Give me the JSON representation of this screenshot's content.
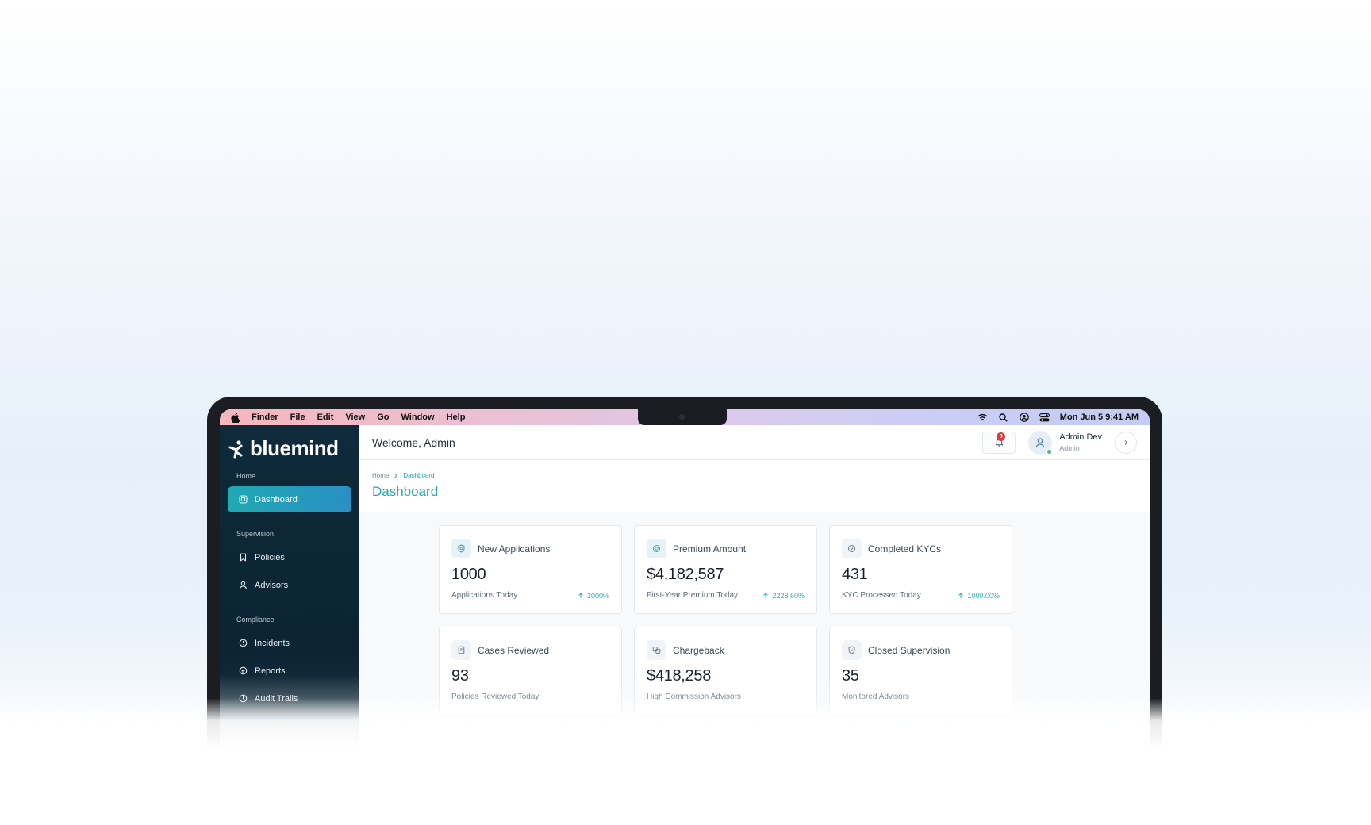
{
  "menubar": {
    "items": [
      "Finder",
      "File",
      "Edit",
      "View",
      "Go",
      "Window",
      "Help"
    ],
    "clock": "Mon Jun 5  9:41 AM",
    "status_icons": [
      "wifi-icon",
      "search-icon",
      "user-circle-icon",
      "control-center-icon"
    ]
  },
  "sidebar": {
    "brand": "bluemind",
    "sections": [
      {
        "label": "Home",
        "items": [
          {
            "label": "Dashboard",
            "icon": "dashboard-icon",
            "active": true
          }
        ]
      },
      {
        "label": "Supervision",
        "items": [
          {
            "label": "Policies",
            "icon": "bookmark-icon"
          },
          {
            "label": "Advisors",
            "icon": "user-icon"
          }
        ]
      },
      {
        "label": "Compliance",
        "items": [
          {
            "label": "Incidents",
            "icon": "alert-circle-icon"
          },
          {
            "label": "Reports",
            "icon": "report-icon"
          },
          {
            "label": "Audit Trails",
            "icon": "clock-icon"
          }
        ]
      }
    ]
  },
  "header": {
    "welcome": "Welcome, Admin",
    "notifications_count": "3",
    "user_name": "Admin Dev",
    "user_role": "Admin"
  },
  "page": {
    "breadcrumb": [
      "Home",
      "Dashboard"
    ],
    "title": "Dashboard"
  },
  "cards": [
    {
      "title": "New Applications",
      "value": "1000",
      "subtitle": "Applications Today",
      "trend": "2000%",
      "icon": "shield-icon"
    },
    {
      "title": "Premium Amount",
      "value": "$4,182,587",
      "subtitle": "First-Year Premium Today",
      "trend": "2228.60%",
      "icon": "coin-icon"
    },
    {
      "title": "Completed KYCs",
      "value": "431",
      "subtitle": "KYC Processed Today",
      "trend": "1000.00%",
      "icon": "check-shield-icon"
    },
    {
      "title": "Cases Reviewed",
      "value": "93",
      "subtitle": "Policies Reviewed Today",
      "trend": "",
      "icon": "document-icon"
    },
    {
      "title": "Chargeback",
      "value": "$418,258",
      "subtitle": "High Commission Advisors",
      "trend": "",
      "icon": "chargeback-icon"
    },
    {
      "title": "Closed Supervision",
      "value": "35",
      "subtitle": "Monitored Advisors",
      "trend": "",
      "icon": "shield-check-icon"
    }
  ],
  "colors": {
    "accent": "#22a7b5",
    "sidebar_bg": "#0f2a3a",
    "badge": "#e03b3b"
  }
}
